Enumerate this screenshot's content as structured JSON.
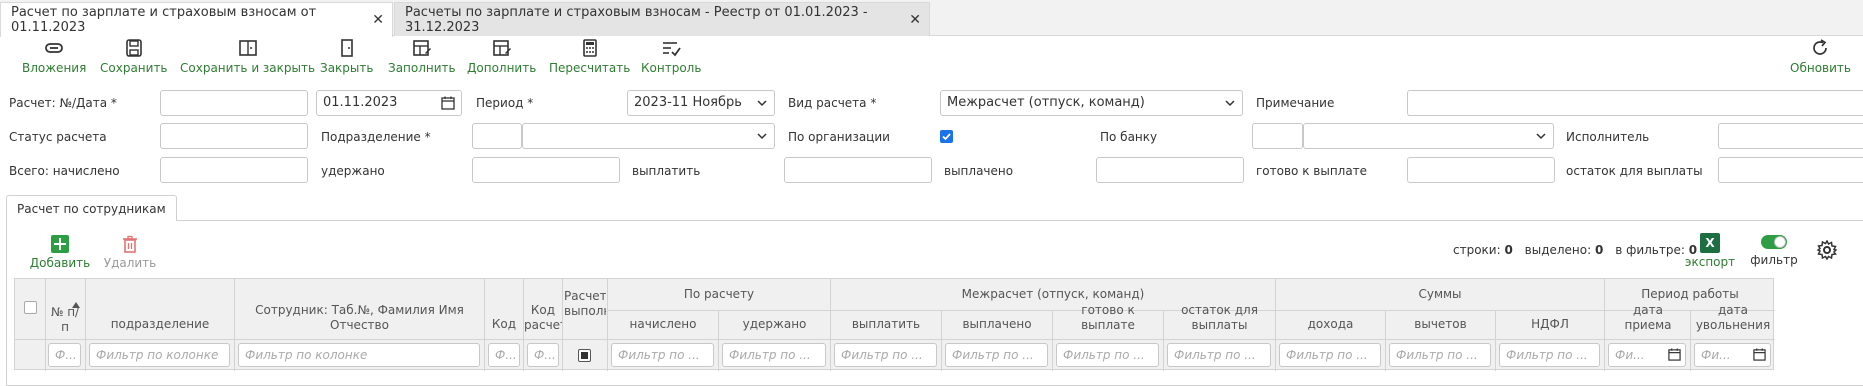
{
  "tabs": [
    {
      "label": "Расчет по зарплате и страховым взносам от 01.11.2023",
      "close": "✕"
    },
    {
      "label": "Расчеты по зарплате и страховым взносам - Реестр от 01.01.2023 - 31.12.2023",
      "close": "✕"
    }
  ],
  "toolbar": {
    "attachments": "Вложения",
    "save": "Сохранить",
    "save_close": "Сохранить и закрыть",
    "close": "Закрыть",
    "fill": "Заполнить",
    "append": "Дополнить",
    "recalc": "Пересчитать",
    "control": "Контроль",
    "refresh": "Обновить",
    "accent_color": "#2e7d32"
  },
  "form": {
    "calc_no_date_label": "Расчет: №/Дата *",
    "date_value": "01.11.2023",
    "period_label": "Период *",
    "period_value": "2023-11 Ноябрь",
    "calc_type_label": "Вид расчета *",
    "calc_type_value": "Межрасчет (отпуск, команд)",
    "note_label": "Примечание",
    "status_label": "Статус расчета",
    "division_label": "Подразделение *",
    "by_org_label": "По организации",
    "by_org_checked": true,
    "by_bank_label": "По банку",
    "executor_label": "Исполнитель",
    "total_accrued_label": "Всего: начислено",
    "withheld_label": "удержано",
    "to_pay_label": "выплатить",
    "paid_label": "выплачено",
    "ready_label": "готово к выплате",
    "remaining_label": "остаток для выплаты"
  },
  "subtab": "Расчет по сотрудникам",
  "grid": {
    "add": "Добавить",
    "delete": "Удалить",
    "rows_label": "строки:",
    "rows_value": "0",
    "selected_label": "выделено:",
    "selected_value": "0",
    "infilter_label": "в фильтре:",
    "infilter_value": "0",
    "export": "экспорт",
    "filter": "фильтр",
    "excel_letter": "X",
    "col_num": "№ п/п",
    "col_division": "подразделение",
    "col_employee": "Сотрудник: Таб.№, Фамилия Имя Отчество",
    "col_code": "Код",
    "col_calc_code": "Код расчета",
    "col_done": "Расчет выполнен",
    "group_by_calc": "По расчету",
    "col_accrued": "начислено",
    "col_withheld": "удержано",
    "group_interim": "Межрасчет (отпуск, команд)",
    "col_to_pay": "выплатить",
    "col_paid": "выплачено",
    "col_ready": "готово к выплате",
    "col_remaining": "остаток для выплаты",
    "group_sums": "Суммы",
    "col_income": "дохода",
    "col_deductions": "вычетов",
    "col_ndfl": "НДФЛ",
    "group_work": "Период работы",
    "col_hire": "дата приема",
    "col_fire": "дата увольнения",
    "filter_placeholder": "Фильтр по колонке",
    "filter_short": "Фильтр по ...",
    "filter_tiny": "Фи...",
    "filter_narrow": "Ф..."
  }
}
